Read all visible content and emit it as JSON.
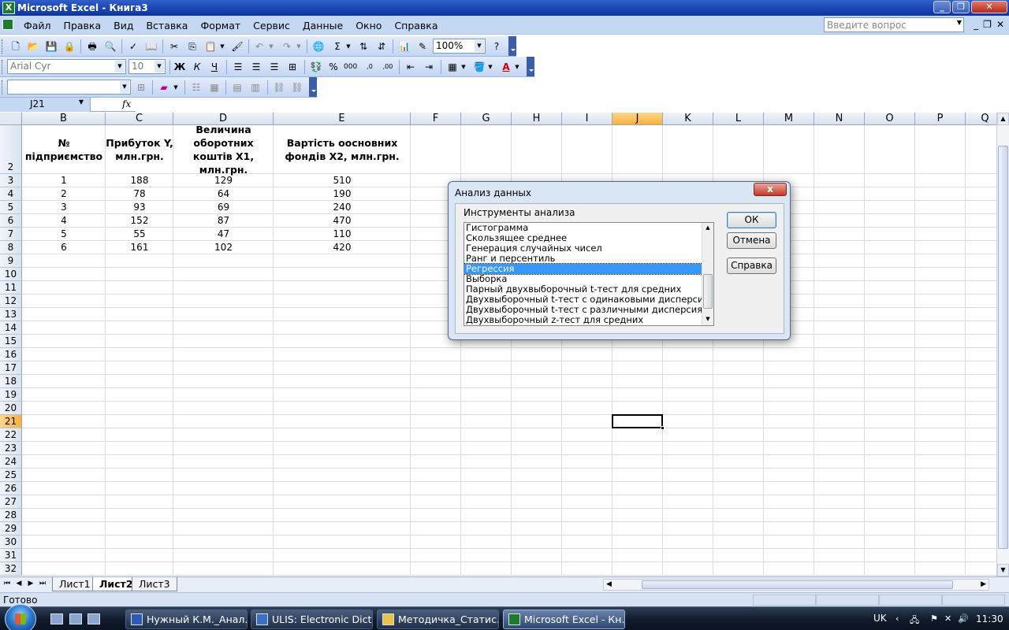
{
  "window": {
    "title": "Microsoft Excel - Книга3"
  },
  "menu": {
    "items": [
      "Файл",
      "Правка",
      "Вид",
      "Вставка",
      "Формат",
      "Сервис",
      "Данные",
      "Окно",
      "Справка"
    ],
    "help_placeholder": "Введите вопрос"
  },
  "toolbar": {
    "zoom": "100%",
    "font_name": "Arial Cyr",
    "font_size": "10"
  },
  "formula_bar": {
    "name_box": "J21",
    "fx_label": "fx",
    "formula": ""
  },
  "columns": [
    "B",
    "C",
    "D",
    "E",
    "F",
    "G",
    "H",
    "I",
    "J",
    "K",
    "L",
    "M",
    "N",
    "O",
    "P",
    "Q"
  ],
  "rows": [
    "2",
    "3",
    "4",
    "5",
    "6",
    "7",
    "8",
    "9",
    "10",
    "11",
    "12",
    "13",
    "14",
    "15",
    "16",
    "17",
    "18",
    "19",
    "20",
    "21",
    "22",
    "23",
    "24",
    "25",
    "26",
    "27",
    "28",
    "29",
    "30",
    "31",
    "32"
  ],
  "table": {
    "headers": [
      "№ підприємство",
      "Прибуток Y, млн.грн.",
      "Величина оборотних коштів X1, млн.грн.",
      "Вартість оосновних фондів X2, млн.грн."
    ],
    "rows": [
      [
        "1",
        "188",
        "129",
        "510"
      ],
      [
        "2",
        "78",
        "64",
        "190"
      ],
      [
        "3",
        "93",
        "69",
        "240"
      ],
      [
        "4",
        "152",
        "87",
        "470"
      ],
      [
        "5",
        "55",
        "47",
        "110"
      ],
      [
        "6",
        "161",
        "102",
        "420"
      ]
    ]
  },
  "sheets": [
    "Лист1",
    "Лист2",
    "Лист3"
  ],
  "active_sheet": "Лист2",
  "status": {
    "text": "Готово"
  },
  "dialog": {
    "title": "Анализ данных",
    "close_label": "x",
    "list_label": "Инструменты анализа",
    "tools": [
      "Гистограмма",
      "Скользящее среднее",
      "Генерация случайных чисел",
      "Ранг и персентиль",
      "Регрессия",
      "Выборка",
      "Парный двухвыборочный t-тест для средних",
      "Двухвыборочный t-тест с одинаковыми дисперсиями",
      "Двухвыборочный t-тест с различными дисперсиями",
      "Двухвыборочный z-тест для средних"
    ],
    "selected_tool": "Регрессия",
    "ok_label": "ОК",
    "cancel_label": "Отмена",
    "help_label": "Справка"
  },
  "taskbar": {
    "tasks": [
      "Нужный К.М._Анал...",
      "ULIS: Electronic Dict...",
      "Методичка_Статис...",
      "Microsoft Excel - Кн..."
    ],
    "active_task": "Microsoft Excel - Кн...",
    "lang": "UK",
    "clock": "11:30"
  }
}
